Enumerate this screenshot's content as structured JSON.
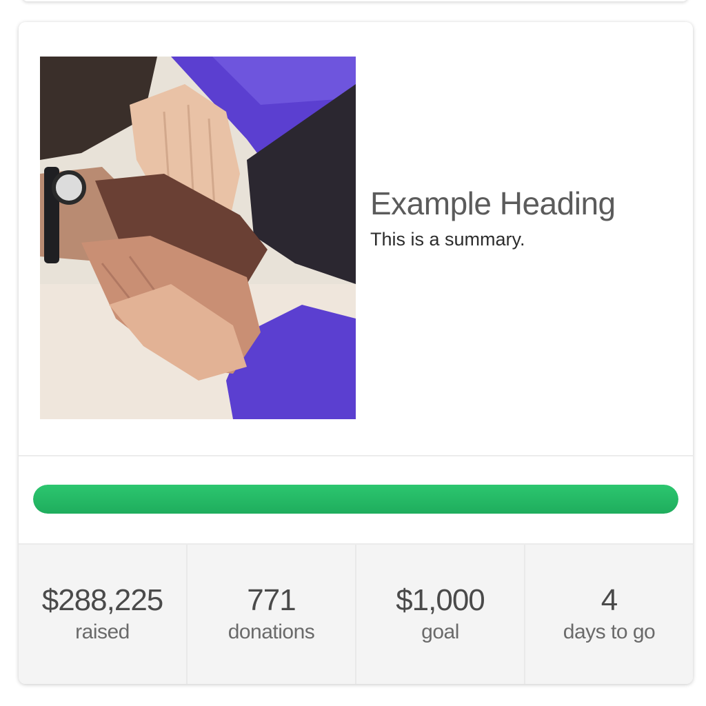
{
  "campaign": {
    "heading": "Example Heading",
    "summary": "This is a summary.",
    "image": {
      "alt": "stacked hands photo",
      "colors": {
        "background": "#e8e2d8",
        "sleeve_purple": "#5b3fd0",
        "sleeve_dark": "#2b2730",
        "skin_light": "#e9c2a6",
        "skin_medium": "#c98f74",
        "skin_dark": "#6a4034"
      }
    }
  },
  "progress": {
    "percent": 100,
    "color": "#22b463"
  },
  "stats": [
    {
      "value": "$288,225",
      "label": "raised"
    },
    {
      "value": "771",
      "label": "donations"
    },
    {
      "value": "$1,000",
      "label": "goal"
    },
    {
      "value": "4",
      "label": "days to go"
    }
  ]
}
